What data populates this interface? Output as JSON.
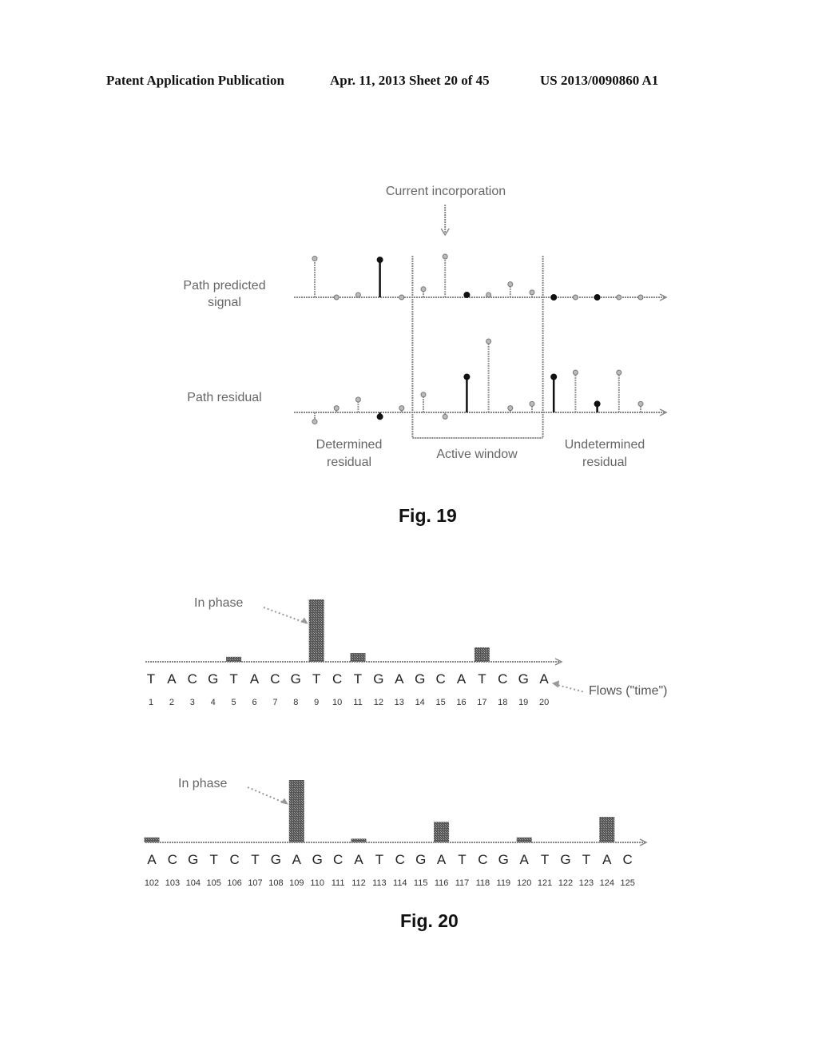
{
  "header": {
    "left": "Patent Application Publication",
    "middle": "Apr. 11, 2013  Sheet 20 of 45",
    "right": "US 2013/0090860 A1"
  },
  "fig19": {
    "caption": "Fig. 19",
    "current_incorporation": "Current incorporation",
    "row_predicted_label": [
      "Path predicted",
      "signal"
    ],
    "row_residual_label": "Path residual",
    "region_labels": {
      "determined": [
        "Determined",
        "residual"
      ],
      "active": "Active window",
      "undetermined": [
        "Undetermined",
        "residual"
      ]
    },
    "active_window": {
      "start_index": 5,
      "end_index": 10
    },
    "current_index": 6,
    "predicted_signal": [
      {
        "v": 0.95,
        "black": false
      },
      {
        "v": 0.0,
        "black": false
      },
      {
        "v": 0.06,
        "black": false
      },
      {
        "v": 0.92,
        "black": true
      },
      {
        "v": 0.0,
        "black": false
      },
      {
        "v": 0.2,
        "black": false
      },
      {
        "v": 1.0,
        "black": false
      },
      {
        "v": 0.06,
        "black": true
      },
      {
        "v": 0.06,
        "black": false
      },
      {
        "v": 0.32,
        "black": false
      },
      {
        "v": 0.12,
        "black": false
      },
      {
        "v": 0.0,
        "black": true
      },
      {
        "v": 0.0,
        "black": false
      },
      {
        "v": 0.0,
        "black": true
      },
      {
        "v": 0.0,
        "black": false
      },
      {
        "v": 0.0,
        "black": false
      }
    ],
    "residual": [
      {
        "v": -0.13,
        "black": false
      },
      {
        "v": 0.06,
        "black": false
      },
      {
        "v": 0.18,
        "black": false
      },
      {
        "v": -0.06,
        "black": true
      },
      {
        "v": 0.06,
        "black": false
      },
      {
        "v": 0.25,
        "black": false
      },
      {
        "v": -0.06,
        "black": false
      },
      {
        "v": 0.5,
        "black": true
      },
      {
        "v": 1.0,
        "black": false
      },
      {
        "v": 0.06,
        "black": false
      },
      {
        "v": 0.12,
        "black": false
      },
      {
        "v": 0.5,
        "black": true
      },
      {
        "v": 0.56,
        "black": false
      },
      {
        "v": 0.12,
        "black": true
      },
      {
        "v": 0.56,
        "black": false
      },
      {
        "v": 0.12,
        "black": false
      }
    ]
  },
  "fig20": {
    "caption": "Fig. 20",
    "panel_a": {
      "annotation": "In phase",
      "axis_label": "Flows (\"time\")",
      "bases": [
        "T",
        "A",
        "C",
        "G",
        "T",
        "A",
        "C",
        "G",
        "T",
        "C",
        "T",
        "G",
        "A",
        "G",
        "C",
        "A",
        "T",
        "C",
        "G",
        "A"
      ],
      "flows": [
        1,
        2,
        3,
        4,
        5,
        6,
        7,
        8,
        9,
        10,
        11,
        12,
        13,
        14,
        15,
        16,
        17,
        18,
        19,
        20
      ],
      "values": [
        0,
        0,
        0,
        0,
        0.08,
        0,
        0,
        0,
        1.0,
        0,
        0.14,
        0,
        0,
        0,
        0,
        0,
        0.23,
        0,
        0,
        0
      ],
      "in_phase_flow": 9
    },
    "panel_b": {
      "annotation": "In phase",
      "bases": [
        "A",
        "C",
        "G",
        "T",
        "C",
        "T",
        "G",
        "A",
        "G",
        "C",
        "A",
        "T",
        "C",
        "G",
        "A",
        "T",
        "C",
        "G",
        "A",
        "T",
        "G",
        "T",
        "A",
        "C"
      ],
      "flows": [
        102,
        103,
        104,
        105,
        106,
        107,
        108,
        109,
        110,
        111,
        112,
        113,
        114,
        115,
        116,
        117,
        118,
        119,
        120,
        121,
        122,
        123,
        124,
        125
      ],
      "values": [
        0.08,
        0,
        0,
        0,
        0,
        0,
        0,
        1.0,
        0,
        0,
        0.06,
        0,
        0,
        0,
        0.33,
        0,
        0,
        0,
        0.08,
        0,
        0,
        0,
        0.41,
        0
      ],
      "in_phase_flow": 109
    }
  },
  "chart_data": [
    {
      "type": "bar",
      "title": "Fig. 20 (top)",
      "xlabel": "Flows (\"time\")",
      "categories": [
        "1 T",
        "2 A",
        "3 C",
        "4 G",
        "5 T",
        "6 A",
        "7 C",
        "8 G",
        "9 T",
        "10 C",
        "11 T",
        "12 G",
        "13 A",
        "14 G",
        "15 C",
        "16 A",
        "17 T",
        "18 C",
        "19 G",
        "20 A"
      ],
      "values": [
        0,
        0,
        0,
        0,
        0.08,
        0,
        0,
        0,
        1.0,
        0,
        0.14,
        0,
        0,
        0,
        0,
        0,
        0.23,
        0,
        0,
        0
      ],
      "annotations": [
        {
          "text": "In phase",
          "target": "9"
        }
      ]
    },
    {
      "type": "bar",
      "title": "Fig. 20 (bottom)",
      "categories": [
        "102 A",
        "103 C",
        "104 G",
        "105 T",
        "106 C",
        "107 T",
        "108 G",
        "109 A",
        "110 G",
        "111 C",
        "112 A",
        "113 T",
        "114 C",
        "115 G",
        "116 A",
        "117 T",
        "118 C",
        "119 G",
        "120 A",
        "121 T",
        "122 G",
        "123 T",
        "124 A",
        "125 C"
      ],
      "values": [
        0.08,
        0,
        0,
        0,
        0,
        0,
        0,
        1.0,
        0,
        0,
        0.06,
        0,
        0,
        0,
        0.33,
        0,
        0,
        0,
        0.08,
        0,
        0,
        0,
        0.41,
        0
      ],
      "annotations": [
        {
          "text": "In phase",
          "target": "109"
        }
      ]
    }
  ]
}
